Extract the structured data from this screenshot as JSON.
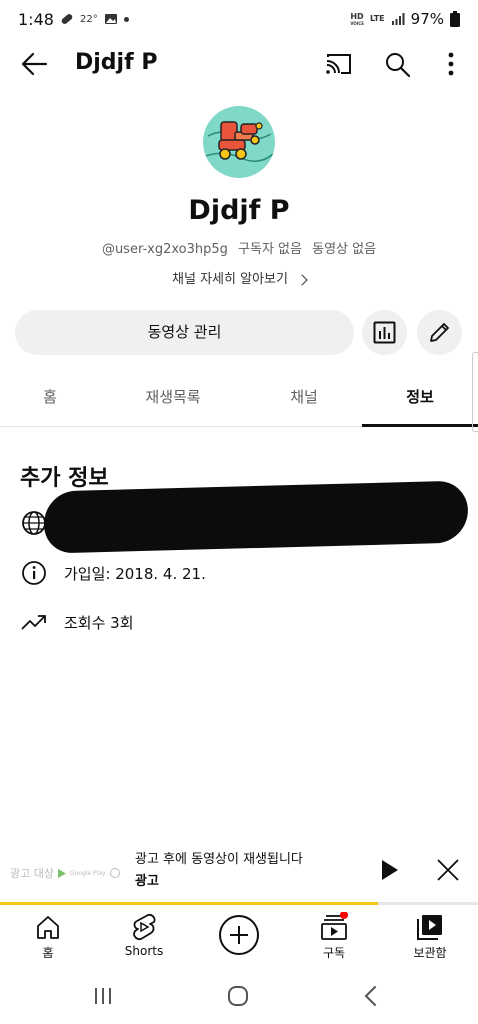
{
  "status_bar": {
    "time": "1:48",
    "temperature": "22°",
    "battery": "97%",
    "network": "LTE",
    "hd": "HD",
    "volte": "VOICE"
  },
  "app_bar": {
    "title": "Djdjf P"
  },
  "channel": {
    "name": "Djdjf P",
    "handle": "@user-xg2xo3hp5g",
    "subscribers": "구독자 없음",
    "videos": "동영상 없음",
    "more_about": "채널 자세히 알아보기"
  },
  "actions": {
    "manage_videos": "동영상 관리"
  },
  "tabs": [
    {
      "label": "홈",
      "active": false
    },
    {
      "label": "재생목록",
      "active": false
    },
    {
      "label": "채널",
      "active": false
    },
    {
      "label": "정보",
      "active": true
    }
  ],
  "about": {
    "section_title": "추가 정보",
    "joined": "가입일: 2018. 4. 21.",
    "views": "조회수 3회"
  },
  "ad": {
    "thumb_label": "광고 대상",
    "thumb_brand": "Google Play",
    "title": "광고 후에 동영상이 재생됩니다",
    "label": "광고",
    "progress_fraction": 0.79,
    "progress_color": "#f5c518"
  },
  "bottom_nav": {
    "items": [
      {
        "label": "홈",
        "icon": "home-icon"
      },
      {
        "label": "Shorts",
        "icon": "shorts-icon"
      },
      {
        "label": "",
        "icon": "create-icon"
      },
      {
        "label": "구독",
        "icon": "subscriptions-icon"
      },
      {
        "label": "보관함",
        "icon": "library-icon"
      }
    ],
    "home_label": "홈",
    "shorts_label": "Shorts",
    "subs_label": "구독",
    "library_label": "보관함"
  },
  "colors": {
    "accent_red": "#ff0000",
    "chip_bg": "#f0f0f0",
    "avatar_bg": "#7fd8c8"
  }
}
